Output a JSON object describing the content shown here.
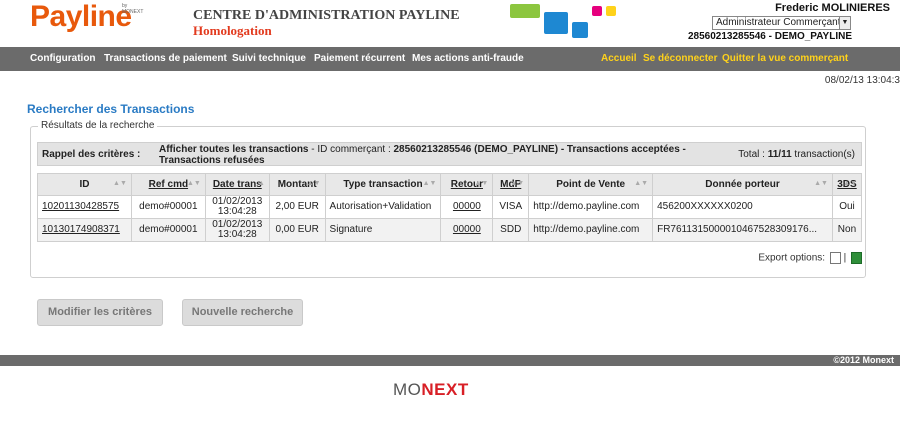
{
  "header": {
    "logo": "Payline",
    "logo_sup": "by MONEXT",
    "title": "CENTRE D'ADMINISTRATION PAYLINE",
    "subtitle": "Homologation",
    "user_name": "Frederic MOLINIERES",
    "role_selected": "Administrateur Commerçant",
    "merchant_id": "28560213285546 - DEMO_PAYLINE"
  },
  "nav": {
    "left": [
      "Configuration",
      "Transactions de paiement",
      "Suivi technique",
      "Paiement récurrent",
      "Mes actions anti-fraude"
    ],
    "right": [
      "Accueil",
      "Se déconnecter",
      "Quitter la vue commerçant"
    ]
  },
  "datetime": "08/02/13 13:04:3",
  "page_title": "Rechercher des Transactions",
  "results_legend": "Résultats de la recherche",
  "criteria": {
    "label": "Rappel des critères :",
    "text_bold1": "Afficher toutes les transactions",
    "text_norm1": " - ID commerçant : ",
    "text_bold2": "28560213285546 (DEMO_PAYLINE) - Transactions acceptées - Transactions refusées",
    "total_label": "Total : ",
    "total_value": "11/11",
    "total_suffix": " transaction(s)"
  },
  "table": {
    "columns": [
      "ID",
      "Ref cmd",
      "Date trans",
      "Montant",
      "Type transaction",
      "Retour",
      "MdP",
      "Point de Vente",
      "Donnée porteur",
      "3DS"
    ],
    "rows": [
      [
        "10201130428575",
        "demo#00001",
        "01/02/2013 13:04:28",
        "2,00 EUR",
        "Autorisation+Validation",
        "00000",
        "VISA",
        "http://demo.payline.com",
        "456200XXXXXX0200",
        "Oui"
      ],
      [
        "10130174908371",
        "demo#00001",
        "01/02/2013 13:04:28",
        "0,00 EUR",
        "Signature",
        "00000",
        "SDD",
        "http://demo.payline.com",
        "FR7611315000010467528309176...",
        "Non"
      ]
    ]
  },
  "export_label": "Export options:",
  "buttons": {
    "modify": "Modifier les critères",
    "new_search": "Nouvelle recherche"
  },
  "footer": {
    "copyright": "©2012 Monext",
    "brand_a": "MO",
    "brand_b": "NEXT"
  },
  "colors": {
    "accent": "#2a7bc4",
    "nav": "#6b6b6b",
    "nav_highlight": "#ffd21a",
    "brand": "#e8590c"
  }
}
